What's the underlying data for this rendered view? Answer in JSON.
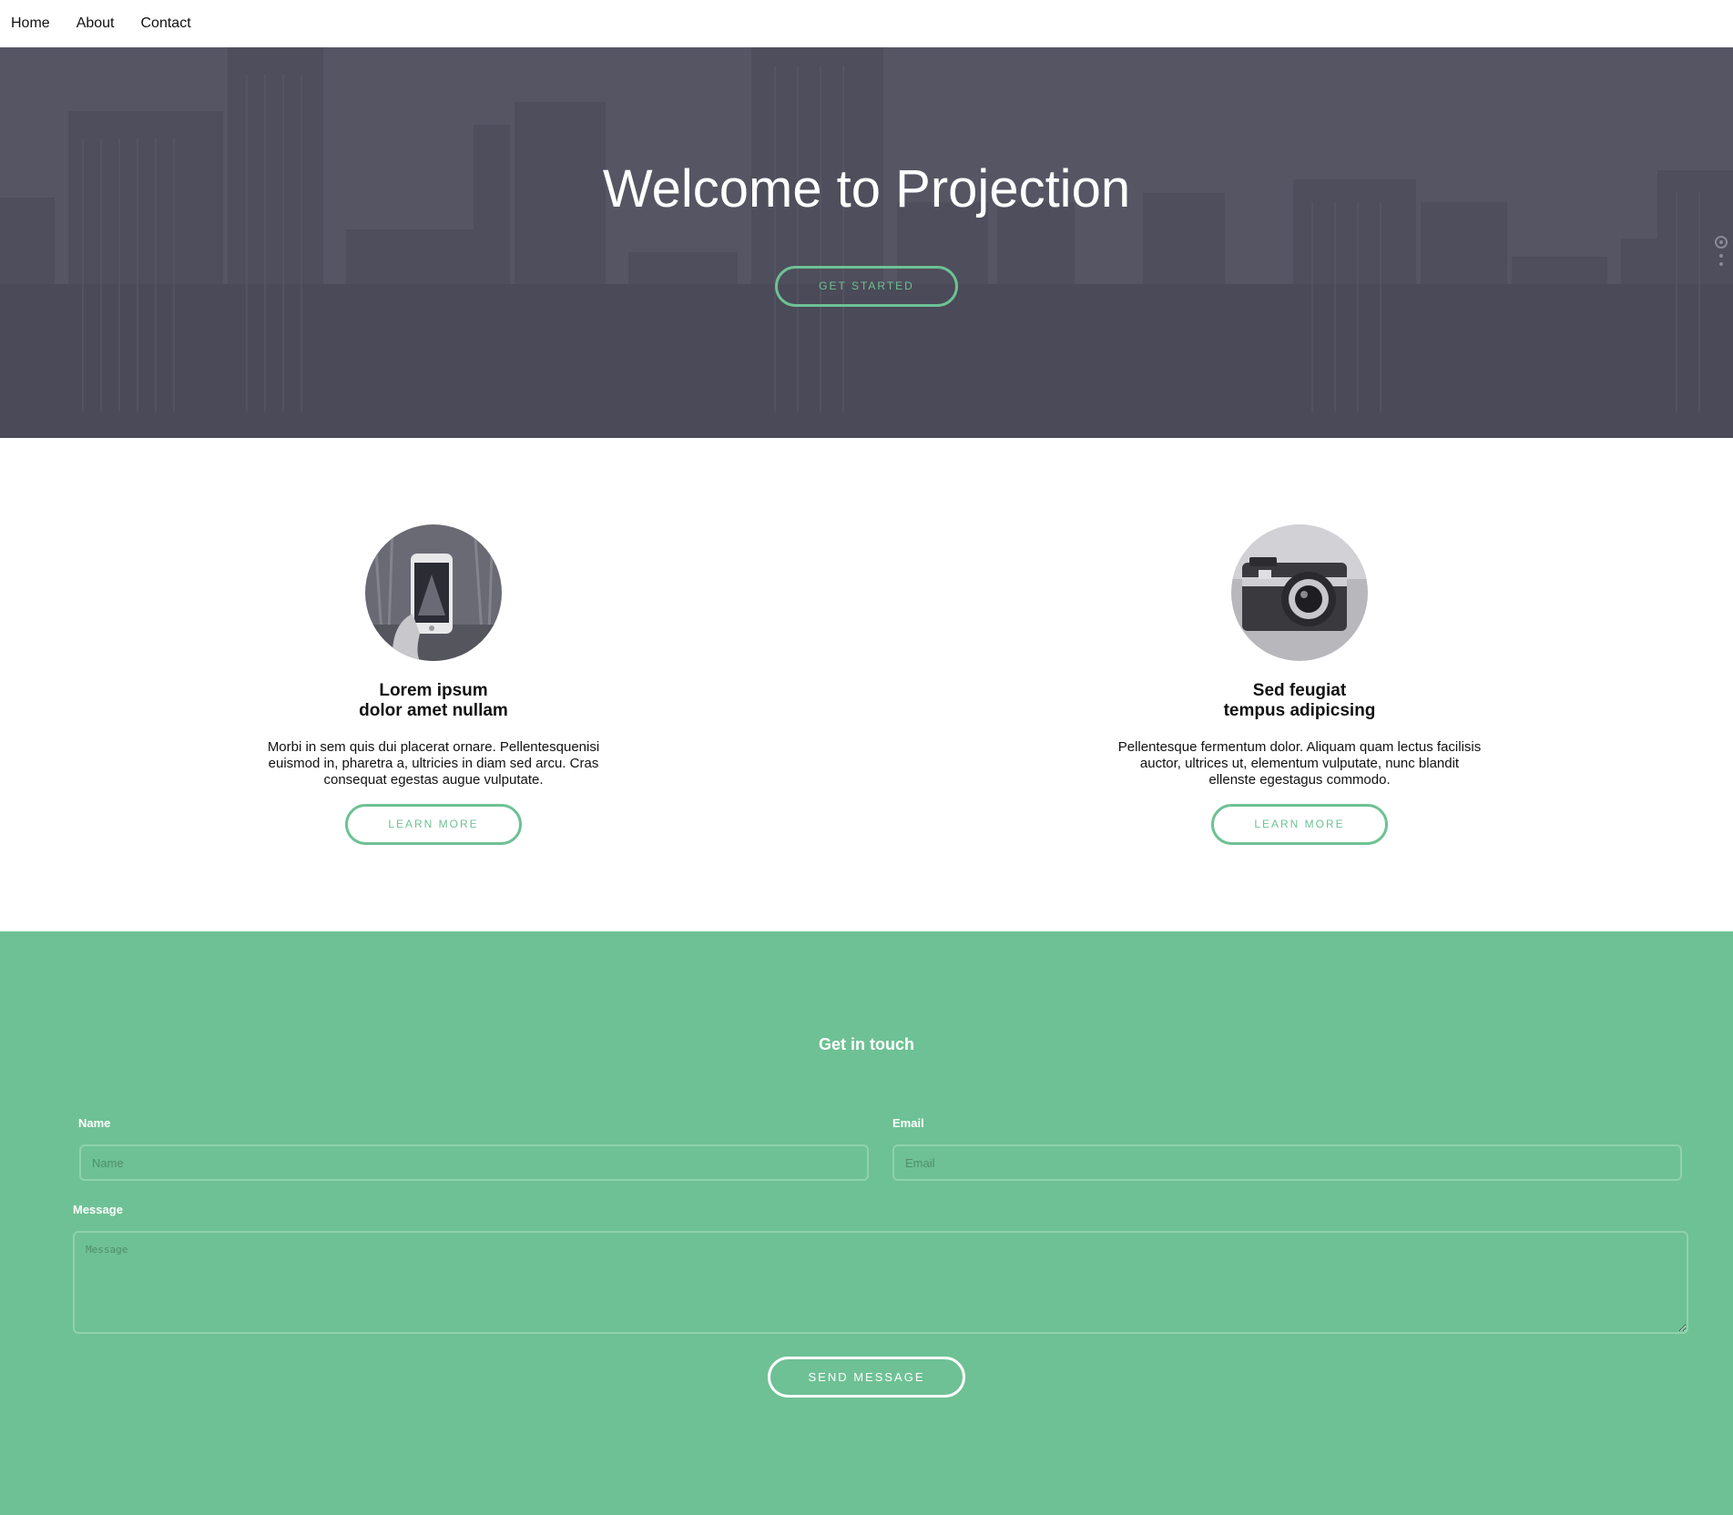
{
  "nav": {
    "items": [
      {
        "label": "Home"
      },
      {
        "label": "About"
      },
      {
        "label": "Contact"
      }
    ]
  },
  "hero": {
    "title": "Welcome to Projection",
    "button_label": "GET STARTED"
  },
  "features": [
    {
      "title_line1": "Lorem ipsum",
      "title_line2": "dolor amet nullam",
      "text": "Morbi in sem quis dui placerat ornare. Pellentesquenisi euismod in, pharetra a, ultricies in diam sed arcu. Cras consequat egestas augue vulputate.",
      "button_label": "LEARN MORE",
      "image_icon": "phone-photo-icon"
    },
    {
      "title_line1": "Sed feugiat",
      "title_line2": "tempus adipicsing",
      "text": "Pellentesque fermentum dolor. Aliquam quam lectus facilisis auctor, ultrices ut, elementum vulputate, nunc blandit ellenste egestagus commodo.",
      "button_label": "LEARN MORE",
      "image_icon": "camera-photo-icon"
    }
  ],
  "contact": {
    "heading": "Get in touch",
    "name_label": "Name",
    "name_placeholder": "Name",
    "email_label": "Email",
    "email_placeholder": "Email",
    "message_label": "Message",
    "message_placeholder": "Message",
    "send_label": "SEND MESSAGE"
  },
  "colors": {
    "accent": "#6ec194",
    "hero_overlay": "#53535f"
  }
}
